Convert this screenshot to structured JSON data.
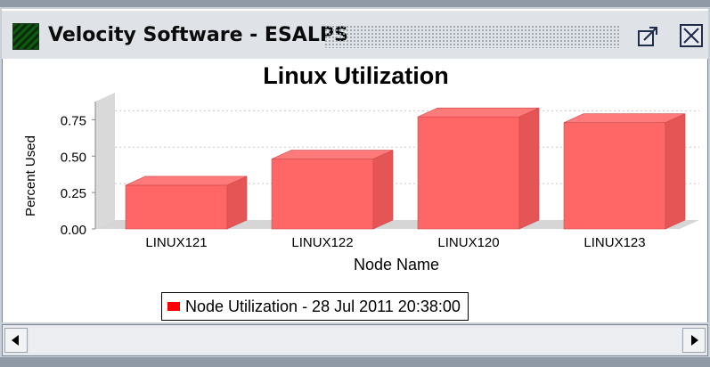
{
  "window": {
    "title": "Velocity Software - ESALPS",
    "icons": {
      "app": "grid-app-icon",
      "maximize": "maximize-icon",
      "close": "close-icon"
    }
  },
  "chart_data": {
    "type": "bar",
    "title": "Linux Utilization",
    "xlabel": "Node Name",
    "ylabel": "Percent Used",
    "categories": [
      "LINUX121",
      "LINUX122",
      "LINUX120",
      "LINUX123"
    ],
    "series": [
      {
        "name": "Node Utilization - 28 Jul 2011 20:38:00",
        "values": [
          0.3,
          0.48,
          0.77,
          0.73
        ]
      }
    ],
    "ylim": [
      0,
      0.875
    ],
    "yticks": [
      "0.00",
      "0.25",
      "0.50",
      "0.75"
    ],
    "grid": true,
    "bar_color": "#ff6666",
    "legend_position": "bottom-center"
  },
  "scrollbar": {
    "left_icon": "arrow-left-icon",
    "right_icon": "arrow-right-icon"
  }
}
